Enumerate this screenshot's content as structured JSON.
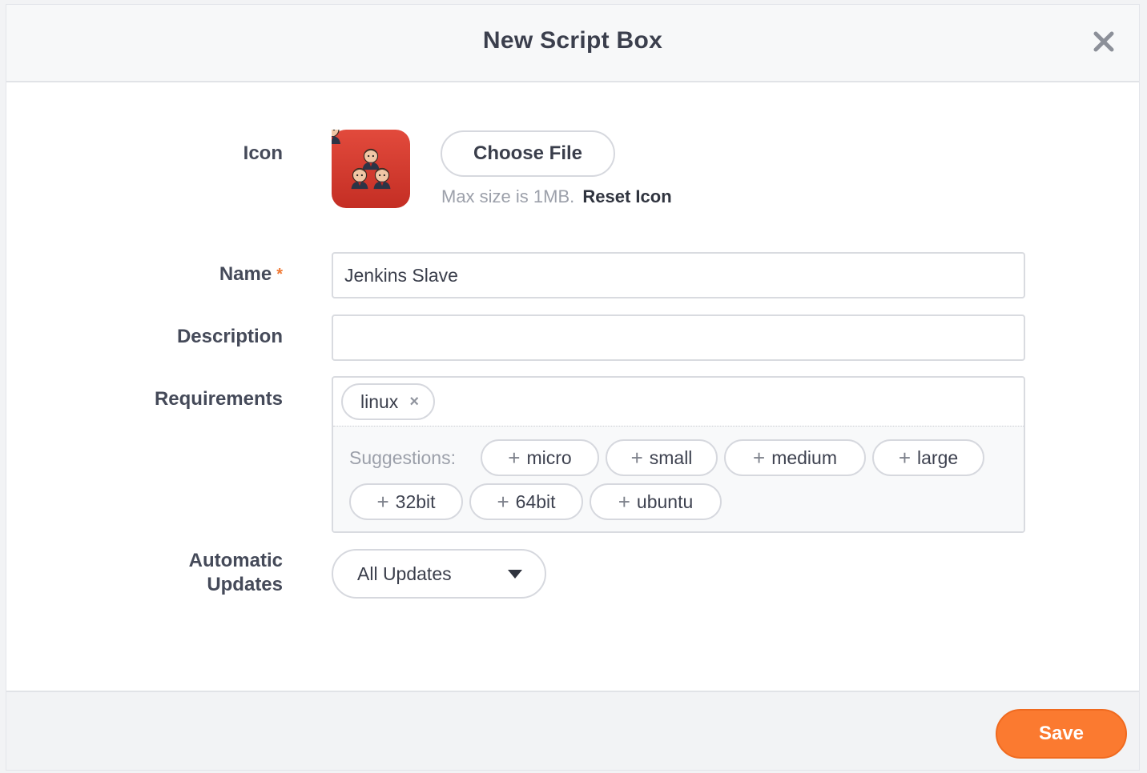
{
  "dialog": {
    "title": "New Script Box"
  },
  "form": {
    "icon": {
      "label": "Icon",
      "choose_file_label": "Choose File",
      "hint": "Max size is 1MB.",
      "reset_label": "Reset Icon",
      "preview_icon": "jenkins-butlers-logo",
      "preview_bg_color": "#d63b2f"
    },
    "name": {
      "label": "Name",
      "required_marker": "*",
      "value": "Jenkins Slave"
    },
    "description": {
      "label": "Description",
      "value": ""
    },
    "requirements": {
      "label": "Requirements",
      "tags": [
        {
          "label": "linux",
          "remove_icon": "×"
        }
      ],
      "suggestions_label": "Suggestions:",
      "suggestion_prefix": "+",
      "suggestions": [
        "micro",
        "small",
        "medium",
        "large",
        "32bit",
        "64bit",
        "ubuntu"
      ]
    },
    "automatic_updates": {
      "label_line1": "Automatic",
      "label_line2": "Updates",
      "selected": "All Updates"
    }
  },
  "footer": {
    "save_label": "Save"
  },
  "colors": {
    "accent": "#fb7a30",
    "required": "#f07a35",
    "icon_bg": "#d63b2f"
  }
}
